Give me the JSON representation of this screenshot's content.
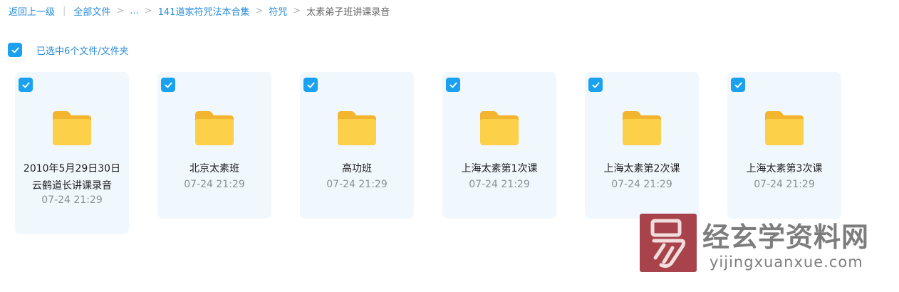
{
  "breadcrumb": {
    "back": "返回上一级",
    "all_files": "全部文件",
    "ellipsis": "...",
    "folder_1": "141道家符咒法本合集",
    "folder_2": "符咒",
    "current": "太素弟子班讲课录音"
  },
  "selection": {
    "label": "已选中6个文件/文件夹",
    "checked": true
  },
  "files": [
    {
      "name": "2010年5月29日30日云鹤道长讲课录音",
      "date": "07-24 21:29",
      "selected": true,
      "type": "folder"
    },
    {
      "name": "北京太素班",
      "date": "07-24 21:29",
      "selected": true,
      "type": "folder"
    },
    {
      "name": "高功班",
      "date": "07-24 21:29",
      "selected": true,
      "type": "folder"
    },
    {
      "name": "上海太素第1次课",
      "date": "07-24 21:29",
      "selected": true,
      "type": "folder"
    },
    {
      "name": "上海太素第2次课",
      "date": "07-24 21:29",
      "selected": true,
      "type": "folder"
    },
    {
      "name": "上海太素第3次课",
      "date": "07-24 21:29",
      "selected": true,
      "type": "folder"
    }
  ],
  "watermark": {
    "title": "经玄学资料网",
    "url": "yijingxuanxue.com"
  },
  "colors": {
    "accent": "#1aa1f0",
    "link": "#2a8cd8",
    "card_bg": "#f0f7fd",
    "folder": "#fcc93c"
  }
}
